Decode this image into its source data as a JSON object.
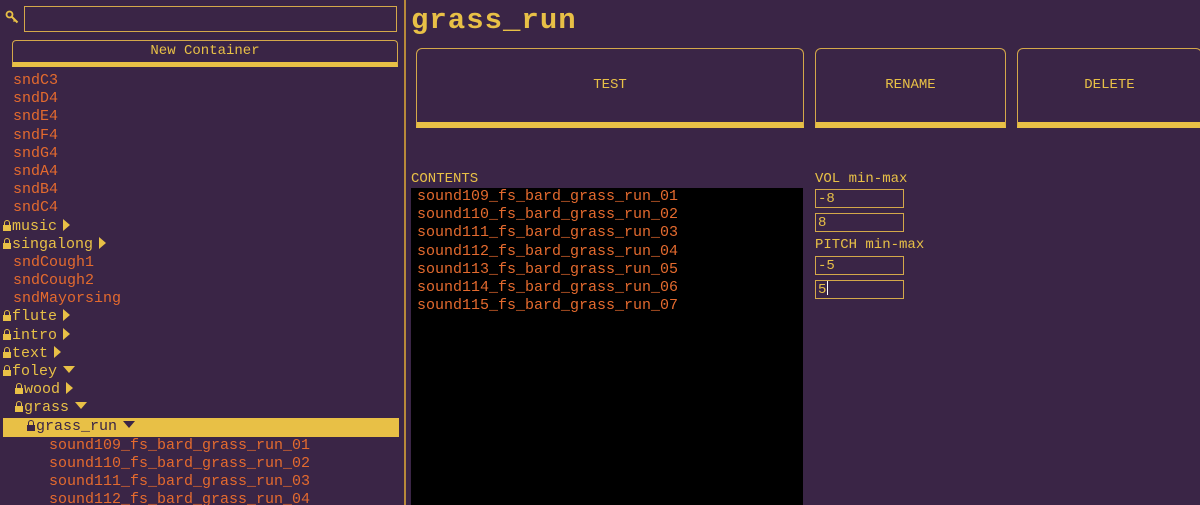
{
  "colors": {
    "background": "#3a2546",
    "accent": "#e8c046",
    "sound_item": "#e46a2e",
    "contents_bg": "#000000"
  },
  "sidebar": {
    "search_icon": "key-icon",
    "search_value": "",
    "new_container_label": "New Container",
    "tree": [
      {
        "label": "sndC3",
        "type": "sound",
        "indent": 0
      },
      {
        "label": "sndD4",
        "type": "sound",
        "indent": 0
      },
      {
        "label": "sndE4",
        "type": "sound",
        "indent": 0
      },
      {
        "label": "sndF4",
        "type": "sound",
        "indent": 0
      },
      {
        "label": "sndG4",
        "type": "sound",
        "indent": 0
      },
      {
        "label": "sndA4",
        "type": "sound",
        "indent": 0
      },
      {
        "label": "sndB4",
        "type": "sound",
        "indent": 0
      },
      {
        "label": "sndC4",
        "type": "sound",
        "indent": 0
      },
      {
        "label": "music",
        "type": "folder",
        "indent": 0,
        "expanded": false
      },
      {
        "label": "singalong",
        "type": "folder",
        "indent": 0,
        "expanded": false
      },
      {
        "label": "sndCough1",
        "type": "sound",
        "indent": 0
      },
      {
        "label": "sndCough2",
        "type": "sound",
        "indent": 0
      },
      {
        "label": "sndMayorsing",
        "type": "sound",
        "indent": 0
      },
      {
        "label": "flute",
        "type": "folder",
        "indent": 0,
        "expanded": false
      },
      {
        "label": "intro",
        "type": "folder",
        "indent": 0,
        "expanded": false
      },
      {
        "label": "text",
        "type": "folder",
        "indent": 0,
        "expanded": false
      },
      {
        "label": "foley",
        "type": "folder",
        "indent": 0,
        "expanded": true
      },
      {
        "label": "wood",
        "type": "folder",
        "indent": 1,
        "expanded": false
      },
      {
        "label": "grass",
        "type": "folder",
        "indent": 1,
        "expanded": true
      },
      {
        "label": "grass_run",
        "type": "folder",
        "indent": 2,
        "expanded": true,
        "selected": true
      },
      {
        "label": "sound109_fs_bard_grass_run_01",
        "type": "sound",
        "indent": 3
      },
      {
        "label": "sound110_fs_bard_grass_run_02",
        "type": "sound",
        "indent": 3
      },
      {
        "label": "sound111_fs_bard_grass_run_03",
        "type": "sound",
        "indent": 3
      },
      {
        "label": "sound112_fs_bard_grass_run_04",
        "type": "sound",
        "indent": 3
      }
    ]
  },
  "main": {
    "title": "grass_run",
    "buttons": {
      "test": "TEST",
      "rename": "RENAME",
      "delete": "DELETE"
    },
    "contents_label": "CONTENTS",
    "contents": [
      "sound109_fs_bard_grass_run_01",
      "sound110_fs_bard_grass_run_02",
      "sound111_fs_bard_grass_run_03",
      "sound112_fs_bard_grass_run_04",
      "sound113_fs_bard_grass_run_05",
      "sound114_fs_bard_grass_run_06",
      "sound115_fs_bard_grass_run_07"
    ],
    "vol_label": "VOL min-max",
    "vol_min": "-8",
    "vol_max": "8",
    "pitch_label": "PITCH min-max",
    "pitch_min": "-5",
    "pitch_max": "5"
  }
}
